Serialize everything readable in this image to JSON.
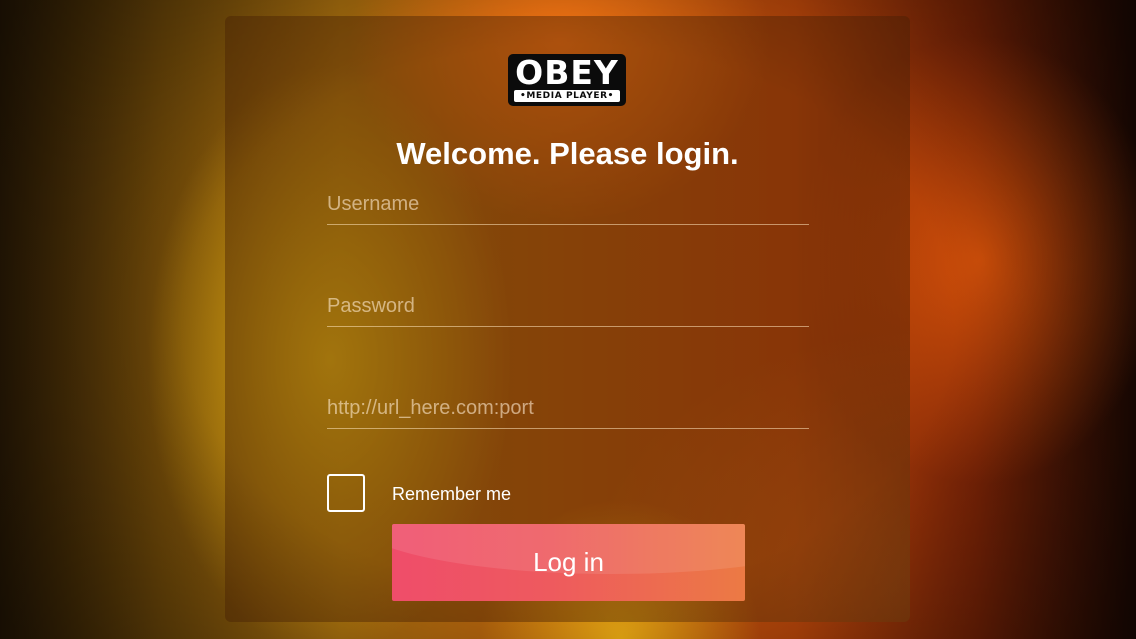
{
  "app": {
    "logo": {
      "main_text": "OBEY",
      "sub_text": "•MEDIA PLAYER•"
    }
  },
  "login": {
    "heading": "Welcome. Please login.",
    "username": {
      "value": "",
      "placeholder": "Username"
    },
    "password": {
      "value": "",
      "placeholder": "Password"
    },
    "url": {
      "value": "",
      "placeholder": "http://url_here.com:port"
    },
    "remember": {
      "label": "Remember me",
      "checked": false
    },
    "submit_label": "Log in"
  },
  "colors": {
    "button_start": "#ef4d6a",
    "button_end": "#ec7a44",
    "panel": "#461e04"
  }
}
